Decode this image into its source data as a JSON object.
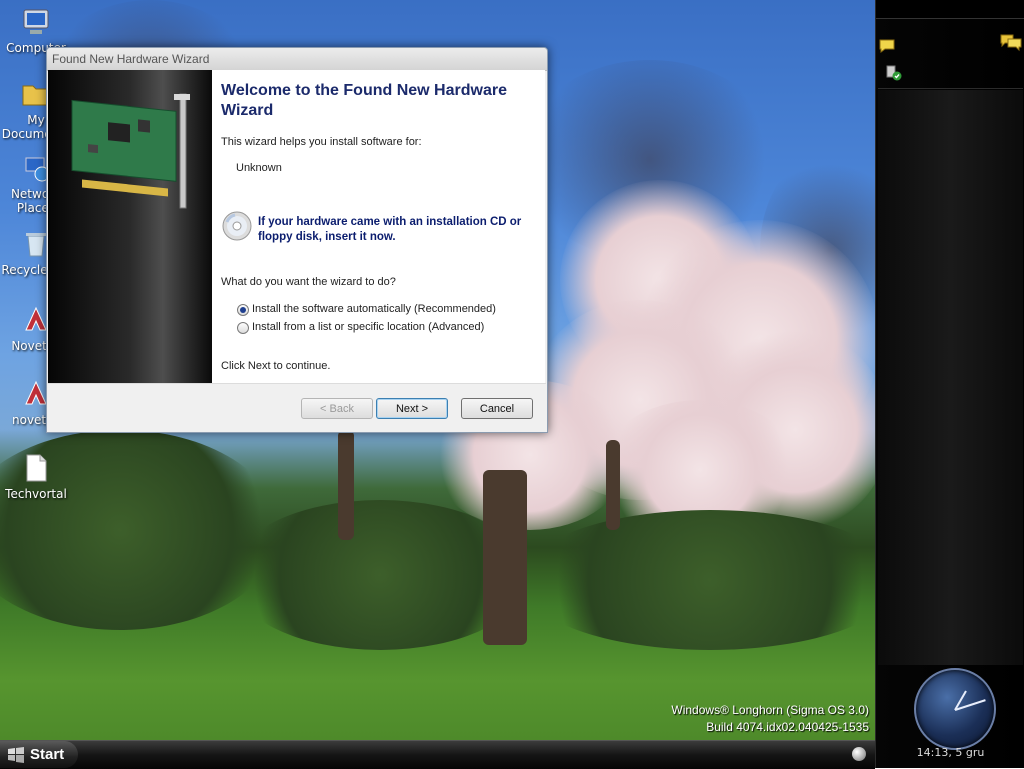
{
  "desktop": {
    "icons": [
      {
        "label": "Computer"
      },
      {
        "label": "My Documents"
      },
      {
        "label": "Network Places"
      },
      {
        "label": "Recycle Bin"
      },
      {
        "label": "Novetus"
      },
      {
        "label": "novetus"
      },
      {
        "label": "Techvortal"
      }
    ]
  },
  "wizard": {
    "title": "Found New Hardware Wizard",
    "heading": "Welcome to the Found New Hardware Wizard",
    "intro": "This wizard helps you install software for:",
    "device": "Unknown",
    "cd_note": "If your hardware came with an installation CD or floppy disk, insert it now.",
    "question": "What do you want the wizard to do?",
    "options": [
      {
        "label": "Install the software automatically (Recommended)",
        "selected": true
      },
      {
        "label": "Install from a list or specific location (Advanced)",
        "selected": false
      }
    ],
    "continue_text": "Click Next to continue.",
    "buttons": {
      "back": "< Back",
      "next": "Next >",
      "cancel": "Cancel"
    }
  },
  "taskbar": {
    "start_label": "Start"
  },
  "watermark": {
    "line1": "Windows® Longhorn (Sigma OS 3.0)",
    "line2": "Build 4074.idx02.040425-1535"
  },
  "sidebar": {
    "clock_text": "14:13, 5 gru"
  },
  "colors": {
    "wizard_heading": "#1b2a6b",
    "taskbar": "#151515",
    "sidebar": "#000000"
  }
}
